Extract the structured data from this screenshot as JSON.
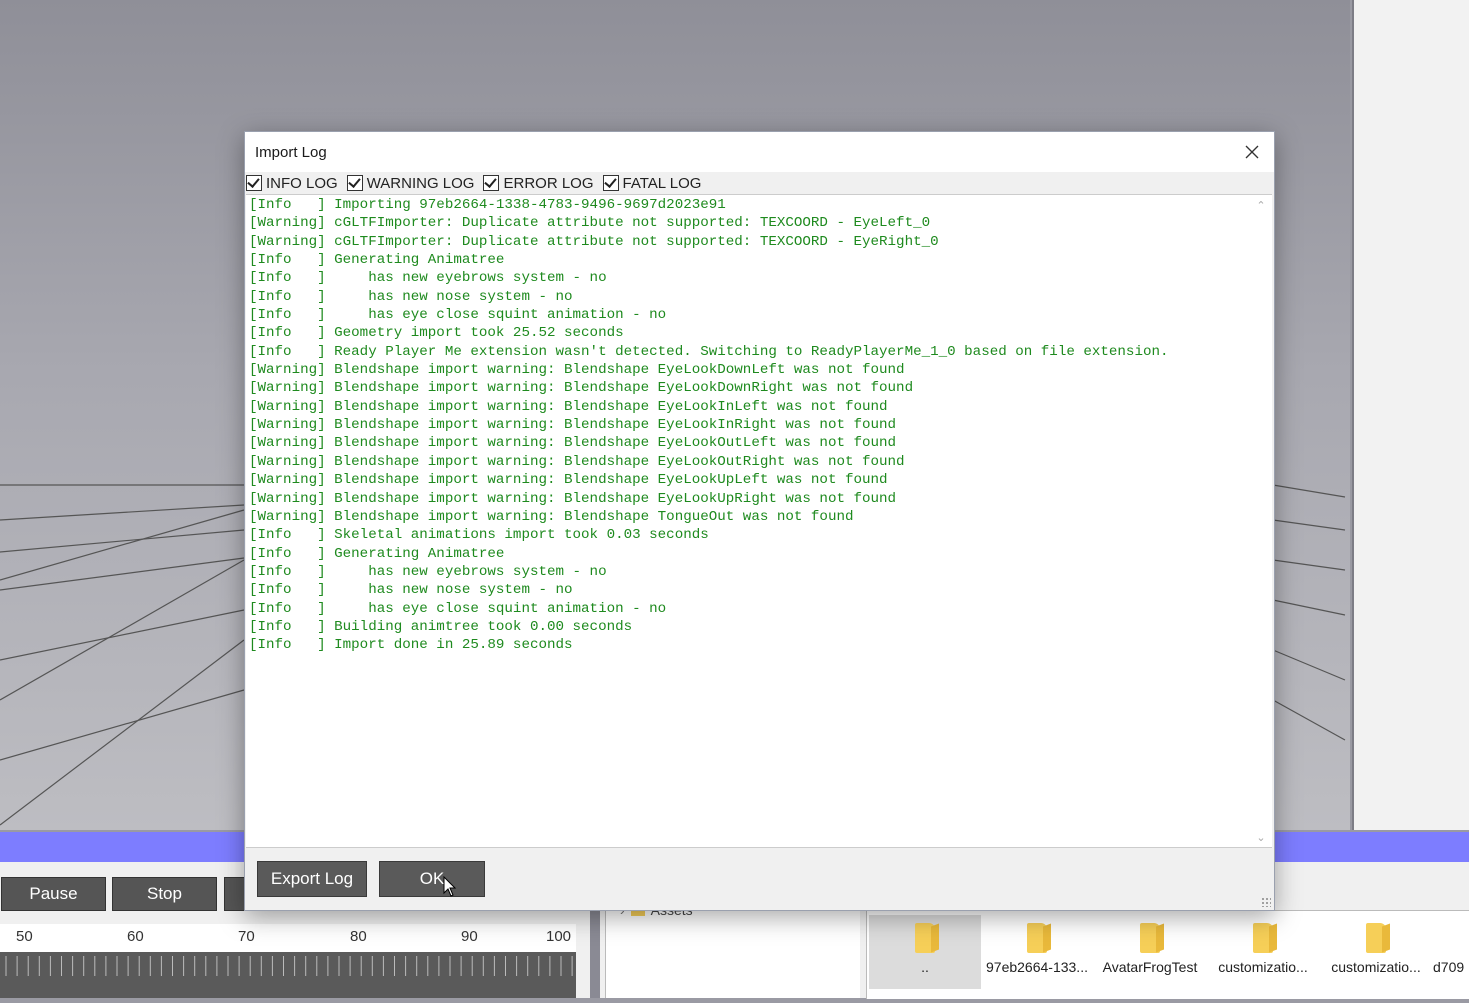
{
  "dialog": {
    "title": "Import Log",
    "filters": [
      "INFO LOG",
      "WARNING LOG",
      "ERROR LOG",
      "FATAL LOG"
    ],
    "log_lines": [
      "[Info   ] Importing 97eb2664-1338-4783-9496-9697d2023e91",
      "[Warning] cGLTFImporter: Duplicate attribute not supported: TEXCOORD - EyeLeft_0",
      "[Warning] cGLTFImporter: Duplicate attribute not supported: TEXCOORD - EyeRight_0",
      "[Info   ] Generating Animatree",
      "[Info   ]     has new eyebrows system - no",
      "[Info   ]     has new nose system - no",
      "[Info   ]     has eye close squint animation - no",
      "[Info   ] Geometry import took 25.52 seconds",
      "[Info   ] Ready Player Me extension wasn't detected. Switching to ReadyPlayerMe_1_0 based on file extension.",
      "[Warning] Blendshape import warning: Blendshape EyeLookDownLeft was not found",
      "[Warning] Blendshape import warning: Blendshape EyeLookDownRight was not found",
      "[Warning] Blendshape import warning: Blendshape EyeLookInLeft was not found",
      "[Warning] Blendshape import warning: Blendshape EyeLookInRight was not found",
      "[Warning] Blendshape import warning: Blendshape EyeLookOutLeft was not found",
      "[Warning] Blendshape import warning: Blendshape EyeLookOutRight was not found",
      "[Warning] Blendshape import warning: Blendshape EyeLookUpLeft was not found",
      "[Warning] Blendshape import warning: Blendshape EyeLookUpRight was not found",
      "[Warning] Blendshape import warning: Blendshape TongueOut was not found",
      "[Info   ] Skeletal animations import took 0.03 seconds",
      "[Info   ] Generating Animatree",
      "[Info   ]     has new eyebrows system - no",
      "[Info   ]     has new nose system - no",
      "[Info   ]     has eye close squint animation - no",
      "[Info   ] Building animtree took 0.00 seconds",
      "[Info   ] Import done in 25.89 seconds"
    ],
    "export_label": "Export Log",
    "ok_label": "OK"
  },
  "playback": {
    "pause_label": "Pause",
    "stop_label": "Stop"
  },
  "ruler": {
    "labels": [
      "50",
      "60",
      "70",
      "80",
      "90",
      "100"
    ]
  },
  "tree": {
    "assets_label": "Assets"
  },
  "files": [
    "..",
    "97eb2664-133...",
    "AvatarFrogTest",
    "customizatio...",
    "customizatio...",
    "d709"
  ],
  "colors": {
    "log_text": "#1e8a1e",
    "accent_bar": "#7d7dff"
  }
}
